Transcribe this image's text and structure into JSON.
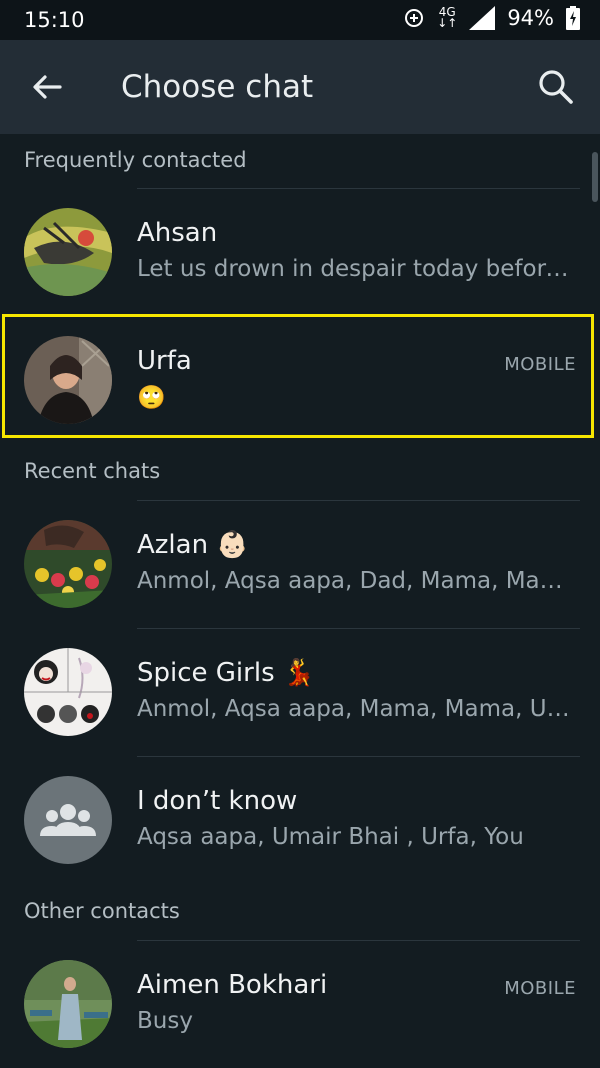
{
  "status_bar": {
    "time": "15:10",
    "network_top": "4G",
    "battery": "94%"
  },
  "app_bar": {
    "title": "Choose chat"
  },
  "sections": {
    "frequent": "Frequently contacted",
    "recent": "Recent chats",
    "other": "Other contacts"
  },
  "contacts": [
    {
      "name": "Ahsan",
      "subtitle": "Let us drown in despair today before h..."
    },
    {
      "name": "Urfa",
      "subtitle": "🙄",
      "tag": "MOBILE"
    },
    {
      "name": "Azlan 👶🏻",
      "subtitle": "Anmol, Aqsa aapa, Dad, Mama, Mama,..."
    },
    {
      "name": "Spice Girls 💃",
      "subtitle": "Anmol, Aqsa aapa, Mama, Mama, Urfa..."
    },
    {
      "name": "I don’t know",
      "subtitle": "Aqsa aapa, Umair Bhai , Urfa, You"
    },
    {
      "name": "Aimen Bokhari",
      "subtitle": "Busy",
      "tag": "MOBILE"
    }
  ],
  "colors": {
    "background": "#131c21",
    "app_bar": "#232d36",
    "highlight": "#f7e600"
  }
}
